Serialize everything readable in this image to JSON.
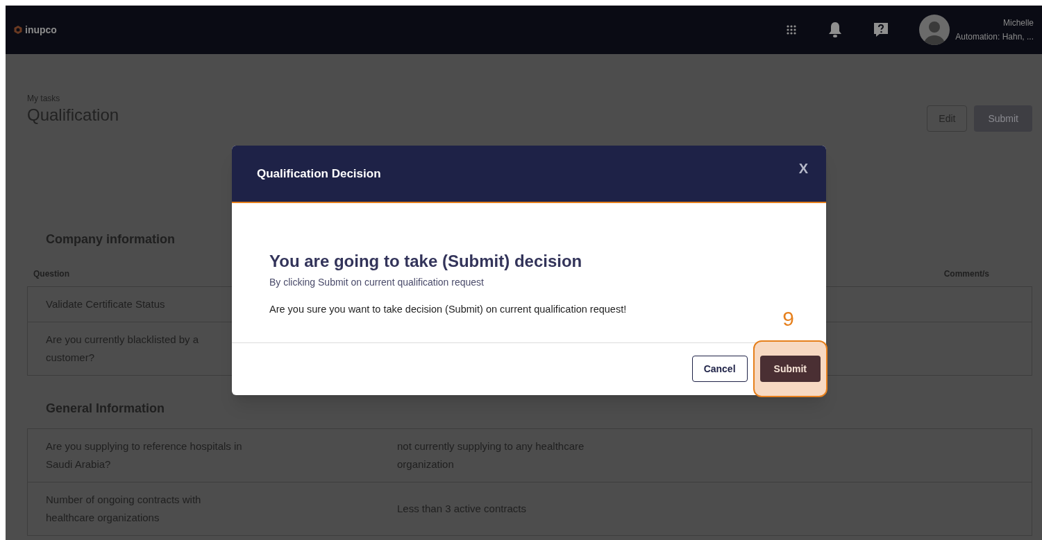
{
  "top_bar": {
    "logo": "inupco",
    "user": {
      "name": "Michelle",
      "role": "Automation: Hahn, ..."
    }
  },
  "page": {
    "breadcrumb": "My tasks",
    "title": "Qualification",
    "actions": [
      {
        "label": "Edit",
        "kind": "outline"
      },
      {
        "label": "Submit",
        "kind": "filled"
      }
    ]
  },
  "sections": [
    {
      "title": "Company information",
      "columns": [
        "Question",
        "Comment/s"
      ],
      "rows": [
        {
          "question": "Validate Certificate Status"
        },
        {
          "question": "Are you currently blacklisted by a customer?"
        }
      ]
    },
    {
      "title": "General Information",
      "rows": [
        {
          "question": "Are you supplying to reference hospitals in Saudi Arabia?",
          "answer": "not currently supplying to any healthcare organization"
        },
        {
          "question": "Number of ongoing contracts with healthcare organizations",
          "answer": "Less than 3 active contracts"
        }
      ]
    }
  ],
  "dialog": {
    "title": "Qualification Decision",
    "close": "X",
    "heading": "You are going to take (Submit) decision",
    "subheading": "By clicking Submit on current qualification request",
    "message": "Are you sure you want to take decision (Submit) on current qualification request!",
    "buttons": [
      {
        "label": "Cancel",
        "kind": "outline",
        "highlighted": false
      },
      {
        "label": "Submit",
        "kind": "filled",
        "highlighted": true
      }
    ],
    "step_marker": "9"
  }
}
